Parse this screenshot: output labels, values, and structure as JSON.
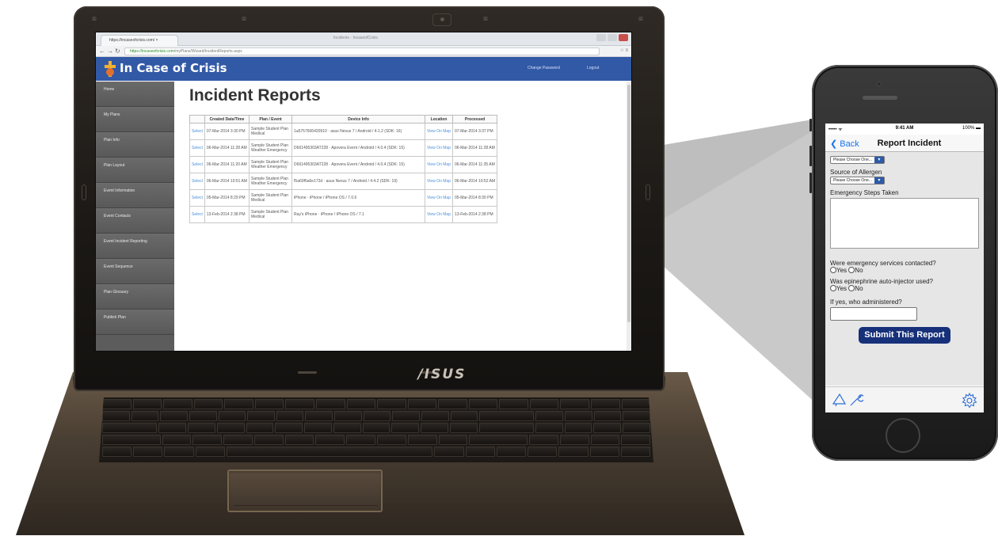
{
  "laptop": {
    "brand": "/ISUS",
    "browser": {
      "tab_title": "https://incaseofcrisis.com/ ×",
      "center_title": "Incidents - IncaseofCrisis",
      "url_secure": "https://",
      "url_host": "incaseofcrisis.com",
      "url_path": "/myPlans/Wizard/IncidentReports.aspx"
    },
    "site": {
      "title": "In Case of Crisis",
      "header_links": [
        "Change Password",
        "Logout"
      ],
      "brand_color": "#3259a6",
      "sidebar": [
        "Home",
        "My Plans",
        "Plan Info",
        "Plan Layout",
        "Event Information",
        "Event Contacts",
        "Event Incident Reporting",
        "Event Sequence",
        "Plan Glossary",
        "Publish Plan"
      ],
      "page_title": "Incident Reports",
      "table": {
        "columns": [
          "",
          "Created Date/Time",
          "Plan / Event",
          "Device Info",
          "Location",
          "Processed"
        ],
        "rows": [
          [
            "Select",
            "07-Mar-2014 3:30 PM",
            "Sample Student Plan Medical",
            "1a5757606420910 · asus Nexus 7 / Android / 4.1.2 (SDK: 16)",
            "View On Map",
            "07-Mar-2014 3:37 PM"
          ],
          [
            "Select",
            "06-Mar-2014 11:28 AM",
            "Sample Student Plan Weather Emergency",
            "D661495303AT228 · Apovera Event / Android / 4.0.4 (SDK: 15)",
            "View On Map",
            "06-Mar-2014 11:28 AM"
          ],
          [
            "Select",
            "06-Mar-2014 11:20 AM",
            "Sample Student Plan Weather Emergency",
            "D661495303AT228 · Apovera Event / Android / 4.0.4 (SDK: 15)",
            "View On Map",
            "06-Mar-2014 11:35 AM"
          ],
          [
            "Select",
            "06-Mar-2014 10:51 AM",
            "Sample Student Plan Weather Emergency",
            "f5a60f6a6e172d · asus Nexus 7 / Android / 4.4.2 (SDK: 19)",
            "View On Map",
            "06-Mar-2014 10:52 AM"
          ],
          [
            "Select",
            "05-Mar-2014 8:29 PM",
            "Sample Student Plan Medical",
            "iPhone · iPhone / iPhone OS / 7.0.6",
            "View On Map",
            "05-Mar-2014 8:30 PM"
          ],
          [
            "Select",
            "13-Feb-2014 2:38 PM",
            "Sample Student Plan Medical",
            "Ray's iPhone · iPhone / iPhone OS / 7.1",
            "View On Map",
            "13-Feb-2014 2:38 PM"
          ]
        ]
      }
    }
  },
  "phone": {
    "status": {
      "signal": "••••• ᯤ",
      "time": "9:41 AM",
      "battery": "100% ▬"
    },
    "nav": {
      "back": "Back",
      "title": "Report Incident"
    },
    "form": {
      "select_placeholder": "Please Choose One...",
      "source_label": "Source of Allergen",
      "steps_label": "Emergency Steps Taken",
      "q1": "Were emergency services contacted?",
      "q2": "Was epinephrine auto-injector used?",
      "yes": "Yes",
      "no": "No",
      "who_label": "If yes, who administered?",
      "submit": "Submit This Report"
    },
    "icons": [
      "megaphone-icon",
      "wrench-icon",
      "gear-icon"
    ],
    "accent": "#17307a"
  }
}
